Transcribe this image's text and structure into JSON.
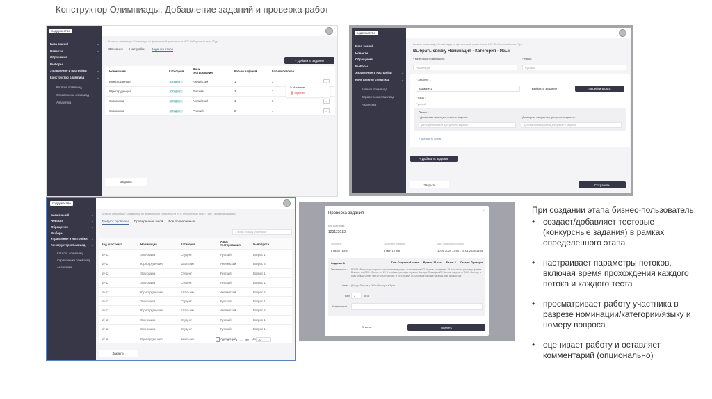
{
  "slide_title": "Конструктор Олимпиады. Добавление заданий и проверка работ",
  "sidebar": {
    "logo": "содружество",
    "items": [
      "База знаний",
      "Новости",
      "Обращения",
      "Выборы",
      "Управление и настройки",
      "Конструктор олимпиад"
    ],
    "sub_items": [
      "Каталог олимпиад",
      "Справочники олимпиад",
      "Аналитика"
    ]
  },
  "screen1": {
    "breadcrumb": "Каталог олимпиад / Олимпиада по финансовой грамотности ИП / Отборочный этап / Тур",
    "tabs": [
      "Описание",
      "Настройки",
      "Задания этапа"
    ],
    "add_button": "+ Добавить задание",
    "headers": [
      "Номинация",
      "Категория",
      "Язык тестирования",
      "Кол-во заданий",
      "Кол-во потоков"
    ],
    "rows": [
      [
        "Юриспруденция",
        "СТУДЕНТ",
        "Английский",
        "1",
        "3"
      ],
      [
        "Юриспруденция",
        "СТУДЕНТ",
        "Русский",
        "2",
        "3"
      ],
      [
        "Экономика",
        "СТУДЕНТ",
        "Английский",
        "1",
        "3"
      ],
      [
        "Экономика",
        "СТУДЕНТ",
        "Русский",
        "2",
        "4"
      ]
    ],
    "menu": {
      "edit": "Изменить",
      "delete": "Удалить"
    },
    "close_button": "Закрыть"
  },
  "screen2": {
    "breadcrumb": "Каталог олимпиад / Олимпиада по финансовой грамотности ИП / Отборочный этап / Тур",
    "heading": "Выбрать связку Номинация - Категория - Язык",
    "nomination_label": "* Категория Номинация :",
    "nomination_placeholder": "Номинация",
    "language_label": "* Язык :",
    "language_value": "Русский",
    "task_label": "* Задание 1 :",
    "task_value": "Задание 1",
    "choose_task": "Выбрать задание",
    "go_lms": "Перейти в LMS",
    "task_language_label": "* Язык :",
    "task_language_value": "Русский",
    "stream_title": "Поток 1",
    "start_label": "* Дата/время начала доступности задания :",
    "start_placeholder": "Дата/время начала доступности задания",
    "end_label": "* Дата/время завершения доступности задания :",
    "end_placeholder": "Дата/время завершения доступности задания",
    "add_stream": "+ Добавить поток",
    "add_task": "+ Добавить задание",
    "close_button": "Закрыть",
    "save_button": "Сохранить"
  },
  "screen3": {
    "breadcrumb": "Каталог олимпиад / Олимпиада по финансовой грамотности ИП / Отборочный этап / Тур / Проверка заданий",
    "tabs": [
      "Требуют проверки",
      "Проверенные мной",
      "Все проверенные"
    ],
    "search_placeholder": "Поиск по коду участника",
    "headers": [
      "Код участника",
      "Номинация",
      "Категория",
      "Язык тестирования",
      "№ вопроса"
    ],
    "rows": [
      [
        "ufl-12",
        "Экономика",
        "Студент",
        "Русский",
        "Вопрос 1"
      ],
      [
        "ufl-12",
        "Юриспруденция",
        "Школьник",
        "Английский",
        "Вопрос 3"
      ],
      [
        "ufl-12",
        "Экономика",
        "Студент",
        "Русский",
        "Вопрос 1"
      ],
      [
        "ufl-12",
        "Экономика",
        "Студент",
        "Русский",
        "Вопрос 1"
      ],
      [
        "ufl-12",
        "Юриспруденция",
        "Школьник",
        "Английский",
        "Вопрос 2"
      ],
      [
        "ufl-12",
        "Экономика",
        "Студент",
        "Русский",
        "Вопрос 1"
      ],
      [
        "ufl-12",
        "Юриспруденция",
        "Школьник",
        "Английский",
        "Вопрос 2"
      ],
      [
        "ufl-12",
        "Экономика",
        "Студент",
        "Русский",
        "Вопрос 1"
      ],
      [
        "ufl-12",
        "Экономика",
        "Студент",
        "Русский",
        "Вопрос 1"
      ],
      [
        "ufl-12",
        "Юриспруденция",
        "Школьник",
        "Английский",
        "Вопрос 3"
      ]
    ],
    "pages": [
      "1",
      "2",
      "3",
      "4",
      "5",
      "…",
      "50"
    ],
    "next": ">",
    "page_size": "10",
    "close_button": "Закрыть"
  },
  "modal": {
    "title": "Проверка задания",
    "close": "×",
    "participant_label": "Код участника:",
    "participant_code": "123123123",
    "stats": [
      {
        "label": "Пройдено",
        "value": "8 из 40 (13%)"
      },
      {
        "label": "Затрачено времени",
        "value": "8 мин 12 сек"
      },
      {
        "label": "Дата начала и окончания",
        "value": "10.01.2024 13:00 - 10.01.2024 13:56"
      }
    ],
    "task": "Задание 1",
    "type": "Тип: Открытый ответ",
    "time": "Время: 38 сек.",
    "score": "Балл: 3",
    "status": "Статус: Проверка",
    "question_label": "Текст вопроса :",
    "question_text": "В 2023 «Вектор» расходы на консалтинговые услуги, выполняемые ИП Чистков, составляют 15 % от общих расходов проекта Вектора, а в ООО «Листок» — 20 % от общих расходов группы и Вектора. Примерно ИП Чистков получил от ООО «Вектор» в разы больше денег, чем от ООО «Листок». У кого из двух ООО больше годовые расходы, и во сколько раз?",
    "answer_label": "Ответ :",
    "answer_text": "Доходы больше у ООО «Вектор», в 3 раз",
    "points_label": "Балл :",
    "points_value": "3",
    "points_max": "из 8",
    "comment_label": "Комментарий :",
    "cancel": "Отмена",
    "submit": "Оценить"
  },
  "notes": {
    "heading": "При создании этапа бизнес-пользователь:",
    "bullets": [
      "создает/добавляет тестовые (конкурсные задания) в рамках определенного этапа",
      "настраивает параметры потоков, включая время прохождения каждого потока и каждого теста",
      "просматривает работу участника в разрезе номинации/категории/языку и номеру вопроса",
      "оценивает работу и оставляет комментарий (опционально)"
    ]
  }
}
